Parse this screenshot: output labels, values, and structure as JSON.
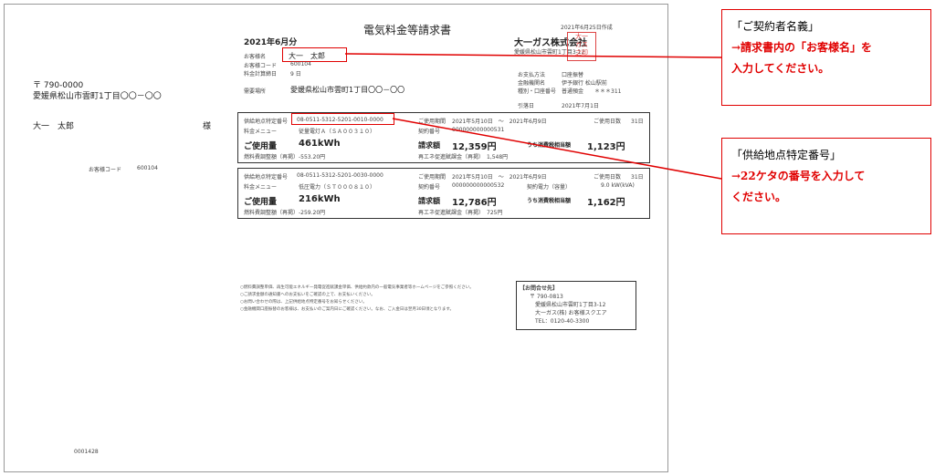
{
  "left_panel": {
    "postal": "〒 790-0000",
    "address": "愛媛県松山市雲町1丁目〇〇－〇〇",
    "name": "大一　太郎",
    "sama": "様",
    "customer_code_label": "お客様コード",
    "customer_code": "600104",
    "doc_number": "0001428"
  },
  "header": {
    "title": "電気料金等請求書",
    "issue_date": "2021年6月25日作成",
    "month": "2021年6月分",
    "company": "大一ガス株式会社",
    "company_address": "愛媛県松山市雲町1丁目3-12",
    "stamp_text": "大一ガス株式会社印"
  },
  "customer_info": {
    "name_label": "お客様名",
    "name": "大一　太郎",
    "code_label": "お客様コード",
    "code": "600104",
    "meter_day_label": "料金計算締日",
    "meter_day": "9 日",
    "location_label": "需要場所",
    "location": "愛媛県松山市雲町1丁目〇〇－〇〇",
    "payment_method_label": "お支払方法",
    "payment_method": "口座振替",
    "bank_label": "金融機関名",
    "bank": "伊予銀行 松山駅前",
    "account_label": "種別・口座番号",
    "account": "普通預金　　＊＊＊311",
    "withdraw_label": "引落日",
    "withdraw_date": "2021年7月1日"
  },
  "contracts": [
    {
      "supply_label": "供給地点特定番号",
      "supply_no": "08-0511-5312-5201-0010-0000",
      "period_label": "ご使用期間",
      "period": "2021年5月10日　～　2021年6月9日",
      "days_label": "ご使用日数",
      "days": "31日",
      "menu_label": "料金メニュー",
      "menu": "従量電灯Ａ（ＳＡ００３１０）",
      "contract_no_label": "契約番号",
      "contract_no": "000000000000531",
      "power_label": "",
      "power": "",
      "usage_label": "ご使用量",
      "usage": "461kWh",
      "amount_label": "請求額",
      "amount": "12,359円",
      "tax_label": "うち消費税相当額",
      "tax": "1,123円",
      "fuel_label": "燃料費調整額（再掲）",
      "fuel": "-553.20円",
      "renew_label": "再エネ促進賦課金（再掲）",
      "renew": "1,548円"
    },
    {
      "supply_label": "供給地点特定番号",
      "supply_no": "08-0511-5312-5201-0030-0000",
      "period_label": "ご使用期間",
      "period": "2021年5月10日　～　2021年6月9日",
      "days_label": "ご使用日数",
      "days": "31日",
      "menu_label": "料金メニュー",
      "menu": "低圧電力（ＳＴ０００８１０）",
      "contract_no_label": "契約番号",
      "contract_no": "000000000000532",
      "power_label": "契約電力（容量）",
      "power": "9.0 kW(kVA)",
      "usage_label": "ご使用量",
      "usage": "216kWh",
      "amount_label": "請求額",
      "amount": "12,786円",
      "tax_label": "うち消費税相当額",
      "tax": "1,162円",
      "fuel_label": "燃料費調整額（再掲）",
      "fuel": "-259.20円",
      "renew_label": "再エネ促進賦課金（再掲）",
      "renew": "725円"
    }
  ],
  "notes": [
    "○燃料費調整単価、再生可能エネルギー発電促進賦課金単価、供給約款内の一般電気事業者等ホームページをご参照ください。",
    "○ご請求金額の通知書へのお支払いをご確認の上で、お支払いください。",
    "○お問い合わせの際は、上記供給地点特定番号をお知らせください。",
    "○金融機関口座振替のお客様は、お支払いのご案内日にご確認ください。なお、ご入金日は翌月30日頃となります。"
  ],
  "inquiry": {
    "title": "【お問合せ先】",
    "postal": "〒 790-0813",
    "address": "愛媛県松山市雲町1丁目3-12",
    "center": "大一ガス(株) お客様スクエア",
    "tel": "TEL：0120-40-3300"
  },
  "callouts": {
    "name_title": "「ご契約者名義」",
    "name_line1": "→請求書内の「お客様名」を",
    "name_line2": "入力してください。",
    "supply_title": "「供給地点特定番号」",
    "supply_line1": "→22ケタの番号を入力して",
    "supply_line2": "ください。"
  },
  "colors": {
    "accent_red": "#e00000",
    "border": "#333333"
  }
}
